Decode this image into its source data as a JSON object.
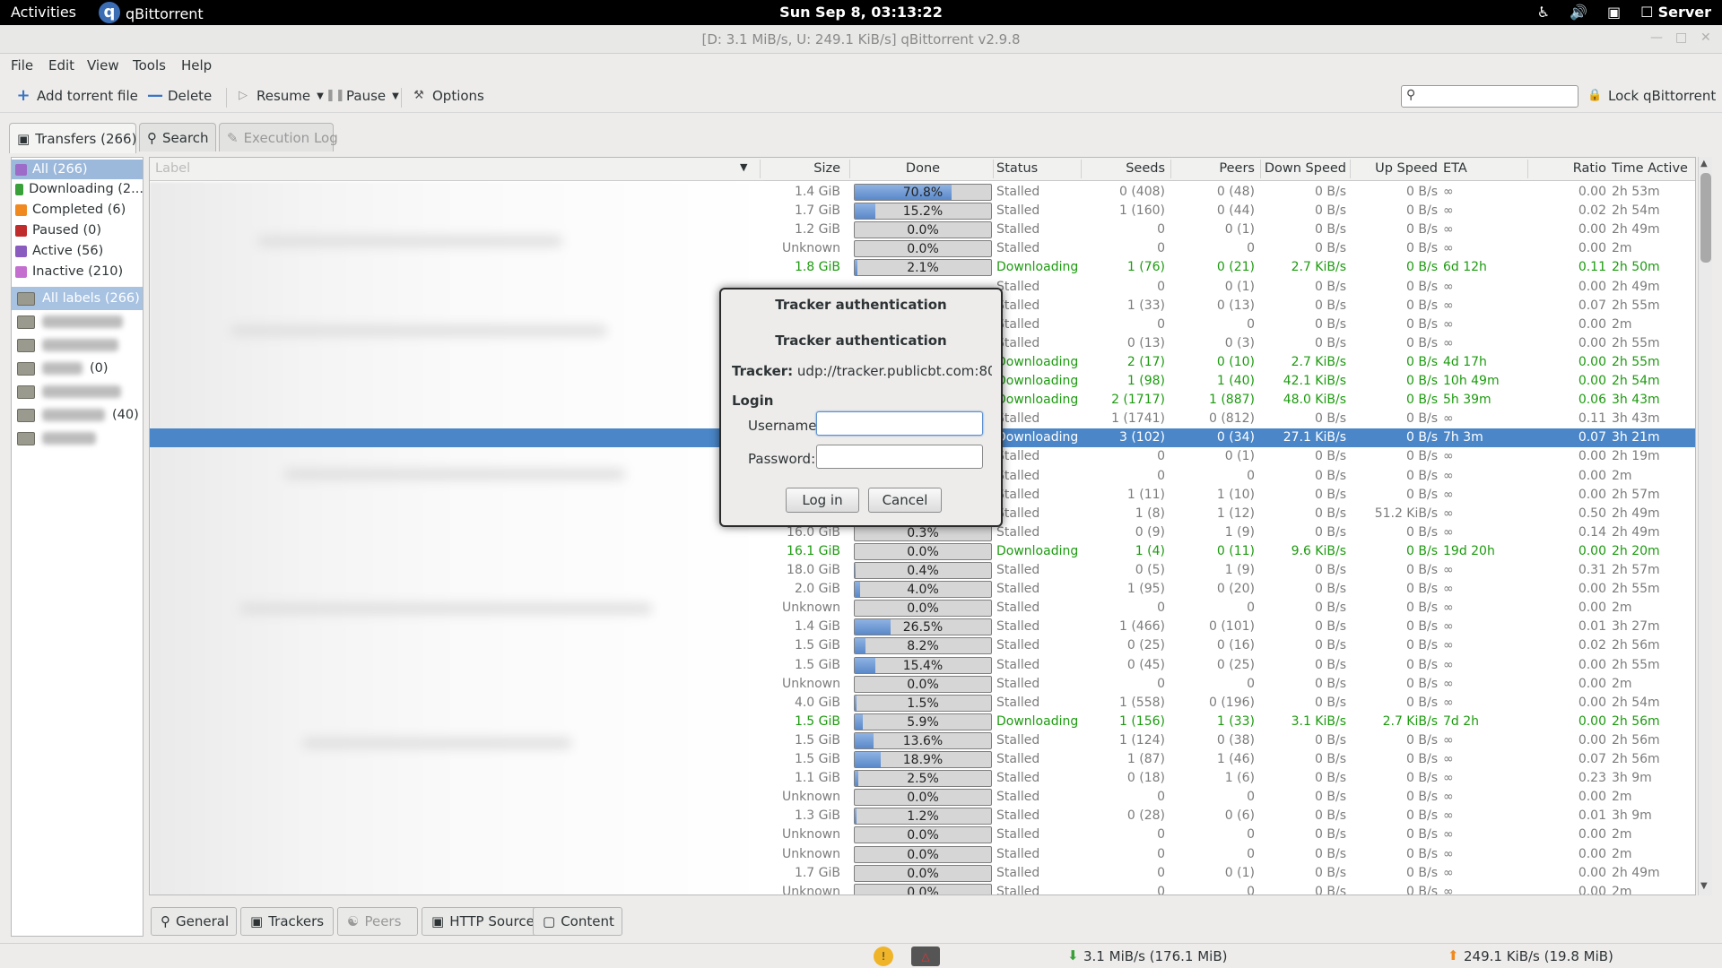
{
  "topbar": {
    "activities": "Activities",
    "app_name": "qBittorrent",
    "clock": "Sun Sep  8, 03:13:22",
    "user": "Server"
  },
  "window": {
    "title": "[D: 3.1 MiB/s, U: 249.1 KiB/s] qBittorrent v2.9.8"
  },
  "menu": [
    "File",
    "Edit",
    "View",
    "Tools",
    "Help"
  ],
  "toolbar": {
    "add": "Add torrent file",
    "delete": "Delete",
    "resume": "Resume",
    "pause": "Pause",
    "options": "Options",
    "lock": "Lock qBittorrent"
  },
  "tabs": {
    "transfers": "Transfers (266)",
    "search": "Search",
    "log": "Execution Log"
  },
  "filters": [
    "All (266)",
    "Downloading (2...",
    "Completed (6)",
    "Paused (0)",
    "Active (56)",
    "Inactive (210)"
  ],
  "labels": {
    "all": "All labels (266)",
    "items": [
      "",
      "",
      "(0)",
      "",
      "(40)",
      ""
    ]
  },
  "columns": {
    "label": "Label",
    "size": "Size",
    "done": "Done",
    "status": "Status",
    "seeds": "Seeds",
    "peers": "Peers",
    "down": "Down Speed",
    "up": "Up Speed",
    "eta": "ETA",
    "ratio": "Ratio",
    "time": "Time Active"
  },
  "rows": [
    {
      "size": "1.4 GiB",
      "done": "70.8%",
      "status": "Stalled",
      "seeds": "0 (408)",
      "peers": "0 (48)",
      "down": "0 B/s",
      "up": "0 B/s",
      "eta": "∞",
      "ratio": "0.00",
      "time": "2h 53m",
      "state": "stalled",
      "progress": 0.708
    },
    {
      "size": "1.7 GiB",
      "done": "15.2%",
      "status": "Stalled",
      "seeds": "1 (160)",
      "peers": "0 (44)",
      "down": "0 B/s",
      "up": "0 B/s",
      "eta": "∞",
      "ratio": "0.02",
      "time": "2h 54m",
      "state": "stalled",
      "progress": 0.152
    },
    {
      "size": "1.2 GiB",
      "done": "0.0%",
      "status": "Stalled",
      "seeds": "0",
      "peers": "0 (1)",
      "down": "0 B/s",
      "up": "0 B/s",
      "eta": "∞",
      "ratio": "0.00",
      "time": "2h 49m",
      "state": "stalled",
      "progress": 0
    },
    {
      "size": "Unknown",
      "done": "0.0%",
      "status": "Stalled",
      "seeds": "0",
      "peers": "0",
      "down": "0 B/s",
      "up": "0 B/s",
      "eta": "∞",
      "ratio": "0.00",
      "time": "2m",
      "state": "stalled",
      "progress": 0
    },
    {
      "size": "1.8 GiB",
      "done": "2.1%",
      "status": "Downloading",
      "seeds": "1 (76)",
      "peers": "0 (21)",
      "down": "2.7 KiB/s",
      "up": "0 B/s",
      "eta": "6d 12h",
      "ratio": "0.11",
      "time": "2h 50m",
      "state": "dl",
      "progress": 0.021
    },
    {
      "size": "",
      "done": "",
      "status": "Stalled",
      "seeds": "0",
      "peers": "0 (1)",
      "down": "0 B/s",
      "up": "0 B/s",
      "eta": "∞",
      "ratio": "0.00",
      "time": "2h 49m",
      "state": "stalled",
      "progress": 0
    },
    {
      "size": "",
      "done": "",
      "status": "Stalled",
      "seeds": "1 (33)",
      "peers": "0 (13)",
      "down": "0 B/s",
      "up": "0 B/s",
      "eta": "∞",
      "ratio": "0.07",
      "time": "2h 55m",
      "state": "stalled",
      "progress": 0
    },
    {
      "size": "",
      "done": "",
      "status": "Stalled",
      "seeds": "0",
      "peers": "0",
      "down": "0 B/s",
      "up": "0 B/s",
      "eta": "∞",
      "ratio": "0.00",
      "time": "2m",
      "state": "stalled",
      "progress": 0
    },
    {
      "size": "",
      "done": "",
      "status": "Stalled",
      "seeds": "0 (13)",
      "peers": "0 (3)",
      "down": "0 B/s",
      "up": "0 B/s",
      "eta": "∞",
      "ratio": "0.00",
      "time": "2h 55m",
      "state": "stalled",
      "progress": 0
    },
    {
      "size": "",
      "done": "",
      "status": "Downloading",
      "seeds": "2 (17)",
      "peers": "0 (10)",
      "down": "2.7 KiB/s",
      "up": "0 B/s",
      "eta": "4d 17h",
      "ratio": "0.00",
      "time": "2h 55m",
      "state": "dl",
      "progress": 0
    },
    {
      "size": "",
      "done": "",
      "status": "Downloading",
      "seeds": "1 (98)",
      "peers": "1 (40)",
      "down": "42.1 KiB/s",
      "up": "0 B/s",
      "eta": "10h 49m",
      "ratio": "0.00",
      "time": "2h 54m",
      "state": "dl",
      "progress": 0
    },
    {
      "size": "",
      "done": "",
      "status": "Downloading",
      "seeds": "2 (1717)",
      "peers": "1 (887)",
      "down": "48.0 KiB/s",
      "up": "0 B/s",
      "eta": "5h 39m",
      "ratio": "0.06",
      "time": "3h 43m",
      "state": "dl",
      "progress": 0
    },
    {
      "size": "",
      "done": "",
      "status": "Stalled",
      "seeds": "1 (1741)",
      "peers": "0 (812)",
      "down": "0 B/s",
      "up": "0 B/s",
      "eta": "∞",
      "ratio": "0.11",
      "time": "3h 43m",
      "state": "stalled",
      "progress": 0
    },
    {
      "size": "",
      "done": "",
      "status": "Downloading",
      "seeds": "3 (102)",
      "peers": "0 (34)",
      "down": "27.1 KiB/s",
      "up": "0 B/s",
      "eta": "7h 3m",
      "ratio": "0.07",
      "time": "3h 21m",
      "state": "sel",
      "progress": 0
    },
    {
      "size": "",
      "done": "",
      "status": "Stalled",
      "seeds": "0",
      "peers": "0 (1)",
      "down": "0 B/s",
      "up": "0 B/s",
      "eta": "∞",
      "ratio": "0.00",
      "time": "2h 19m",
      "state": "stalled",
      "progress": 0
    },
    {
      "size": "",
      "done": "",
      "status": "Stalled",
      "seeds": "0",
      "peers": "0",
      "down": "0 B/s",
      "up": "0 B/s",
      "eta": "∞",
      "ratio": "0.00",
      "time": "2m",
      "state": "stalled",
      "progress": 0
    },
    {
      "size": "",
      "done": "",
      "status": "Stalled",
      "seeds": "1 (11)",
      "peers": "1 (10)",
      "down": "0 B/s",
      "up": "0 B/s",
      "eta": "∞",
      "ratio": "0.00",
      "time": "2h 57m",
      "state": "stalled",
      "progress": 0
    },
    {
      "size": "",
      "done": "",
      "status": "Stalled",
      "seeds": "1 (8)",
      "peers": "1 (12)",
      "down": "0 B/s",
      "up": "51.2 KiB/s",
      "eta": "∞",
      "ratio": "0.50",
      "time": "2h 49m",
      "state": "stalled",
      "progress": 0
    },
    {
      "size": "16.0 GiB",
      "done": "0.3%",
      "status": "Stalled",
      "seeds": "0 (9)",
      "peers": "1 (9)",
      "down": "0 B/s",
      "up": "0 B/s",
      "eta": "∞",
      "ratio": "0.14",
      "time": "2h 49m",
      "state": "stalled",
      "progress": 0.003
    },
    {
      "size": "16.1 GiB",
      "done": "0.0%",
      "status": "Downloading",
      "seeds": "1 (4)",
      "peers": "0 (11)",
      "down": "9.6 KiB/s",
      "up": "0 B/s",
      "eta": "19d 20h",
      "ratio": "0.00",
      "time": "2h 20m",
      "state": "dl",
      "progress": 0
    },
    {
      "size": "18.0 GiB",
      "done": "0.4%",
      "status": "Stalled",
      "seeds": "0 (5)",
      "peers": "1 (9)",
      "down": "0 B/s",
      "up": "0 B/s",
      "eta": "∞",
      "ratio": "0.31",
      "time": "2h 57m",
      "state": "stalled",
      "progress": 0.004
    },
    {
      "size": "2.0 GiB",
      "done": "4.0%",
      "status": "Stalled",
      "seeds": "1 (95)",
      "peers": "0 (20)",
      "down": "0 B/s",
      "up": "0 B/s",
      "eta": "∞",
      "ratio": "0.00",
      "time": "2h 55m",
      "state": "stalled",
      "progress": 0.04
    },
    {
      "size": "Unknown",
      "done": "0.0%",
      "status": "Stalled",
      "seeds": "0",
      "peers": "0",
      "down": "0 B/s",
      "up": "0 B/s",
      "eta": "∞",
      "ratio": "0.00",
      "time": "2m",
      "state": "stalled",
      "progress": 0
    },
    {
      "size": "1.4 GiB",
      "done": "26.5%",
      "status": "Stalled",
      "seeds": "1 (466)",
      "peers": "0 (101)",
      "down": "0 B/s",
      "up": "0 B/s",
      "eta": "∞",
      "ratio": "0.01",
      "time": "3h 27m",
      "state": "stalled",
      "progress": 0.265
    },
    {
      "size": "1.5 GiB",
      "done": "8.2%",
      "status": "Stalled",
      "seeds": "0 (25)",
      "peers": "0 (16)",
      "down": "0 B/s",
      "up": "0 B/s",
      "eta": "∞",
      "ratio": "0.02",
      "time": "2h 56m",
      "state": "stalled",
      "progress": 0.082
    },
    {
      "size": "1.5 GiB",
      "done": "15.4%",
      "status": "Stalled",
      "seeds": "0 (45)",
      "peers": "0 (25)",
      "down": "0 B/s",
      "up": "0 B/s",
      "eta": "∞",
      "ratio": "0.00",
      "time": "2h 55m",
      "state": "stalled",
      "progress": 0.154
    },
    {
      "size": "Unknown",
      "done": "0.0%",
      "status": "Stalled",
      "seeds": "0",
      "peers": "0",
      "down": "0 B/s",
      "up": "0 B/s",
      "eta": "∞",
      "ratio": "0.00",
      "time": "2m",
      "state": "stalled",
      "progress": 0
    },
    {
      "size": "4.0 GiB",
      "done": "1.5%",
      "status": "Stalled",
      "seeds": "1 (558)",
      "peers": "0 (196)",
      "down": "0 B/s",
      "up": "0 B/s",
      "eta": "∞",
      "ratio": "0.00",
      "time": "2h 54m",
      "state": "stalled",
      "progress": 0.015
    },
    {
      "size": "1.5 GiB",
      "done": "5.9%",
      "status": "Downloading",
      "seeds": "1 (156)",
      "peers": "1 (33)",
      "down": "3.1 KiB/s",
      "up": "2.7 KiB/s",
      "eta": "7d 2h",
      "ratio": "0.00",
      "time": "2h 56m",
      "state": "dl",
      "progress": 0.059
    },
    {
      "size": "1.5 GiB",
      "done": "13.6%",
      "status": "Stalled",
      "seeds": "1 (124)",
      "peers": "0 (38)",
      "down": "0 B/s",
      "up": "0 B/s",
      "eta": "∞",
      "ratio": "0.00",
      "time": "2h 56m",
      "state": "stalled",
      "progress": 0.136
    },
    {
      "size": "1.5 GiB",
      "done": "18.9%",
      "status": "Stalled",
      "seeds": "1 (87)",
      "peers": "1 (46)",
      "down": "0 B/s",
      "up": "0 B/s",
      "eta": "∞",
      "ratio": "0.07",
      "time": "2h 56m",
      "state": "stalled",
      "progress": 0.189
    },
    {
      "size": "1.1 GiB",
      "done": "2.5%",
      "status": "Stalled",
      "seeds": "0 (18)",
      "peers": "1 (6)",
      "down": "0 B/s",
      "up": "0 B/s",
      "eta": "∞",
      "ratio": "0.23",
      "time": "3h 9m",
      "state": "stalled",
      "progress": 0.025
    },
    {
      "size": "Unknown",
      "done": "0.0%",
      "status": "Stalled",
      "seeds": "0",
      "peers": "0",
      "down": "0 B/s",
      "up": "0 B/s",
      "eta": "∞",
      "ratio": "0.00",
      "time": "2m",
      "state": "stalled",
      "progress": 0
    },
    {
      "size": "1.3 GiB",
      "done": "1.2%",
      "status": "Stalled",
      "seeds": "0 (28)",
      "peers": "0 (6)",
      "down": "0 B/s",
      "up": "0 B/s",
      "eta": "∞",
      "ratio": "0.01",
      "time": "3h 9m",
      "state": "stalled",
      "progress": 0.012
    },
    {
      "size": "Unknown",
      "done": "0.0%",
      "status": "Stalled",
      "seeds": "0",
      "peers": "0",
      "down": "0 B/s",
      "up": "0 B/s",
      "eta": "∞",
      "ratio": "0.00",
      "time": "2m",
      "state": "stalled",
      "progress": 0
    },
    {
      "size": "Unknown",
      "done": "0.0%",
      "status": "Stalled",
      "seeds": "0",
      "peers": "0",
      "down": "0 B/s",
      "up": "0 B/s",
      "eta": "∞",
      "ratio": "0.00",
      "time": "2m",
      "state": "stalled",
      "progress": 0
    },
    {
      "size": "1.7 GiB",
      "done": "0.0%",
      "status": "Stalled",
      "seeds": "0",
      "peers": "0 (1)",
      "down": "0 B/s",
      "up": "0 B/s",
      "eta": "∞",
      "ratio": "0.00",
      "time": "2h 49m",
      "state": "stalled",
      "progress": 0
    },
    {
      "size": "Unknown",
      "done": "0.0%",
      "status": "Stalled",
      "seeds": "0",
      "peers": "0",
      "down": "0 B/s",
      "up": "0 B/s",
      "eta": "∞",
      "ratio": "0.00",
      "time": "2m",
      "state": "stalled",
      "progress": 0
    }
  ],
  "bottom_tabs": [
    "General",
    "Trackers",
    "Peers",
    "HTTP Sources",
    "Content"
  ],
  "status": {
    "down": "3.1 MiB/s (176.1 MiB)",
    "up": "249.1 KiB/s (19.8 MiB)"
  },
  "dialog": {
    "title": "Tracker authentication",
    "heading": "Tracker authentication",
    "tracker_label": "Tracker:",
    "tracker_value": "udp://tracker.publicbt.com:80/announce",
    "login": "Login",
    "username_label": "Username:",
    "password_label": "Password:",
    "username_value": "",
    "password_value": "",
    "login_btn": "Log in",
    "cancel_btn": "Cancel"
  },
  "colors": {
    "downloading": "#1d9b10",
    "stalled": "#7c7c7c",
    "selection": "#4a86c8",
    "progress": "#5a88c9"
  }
}
